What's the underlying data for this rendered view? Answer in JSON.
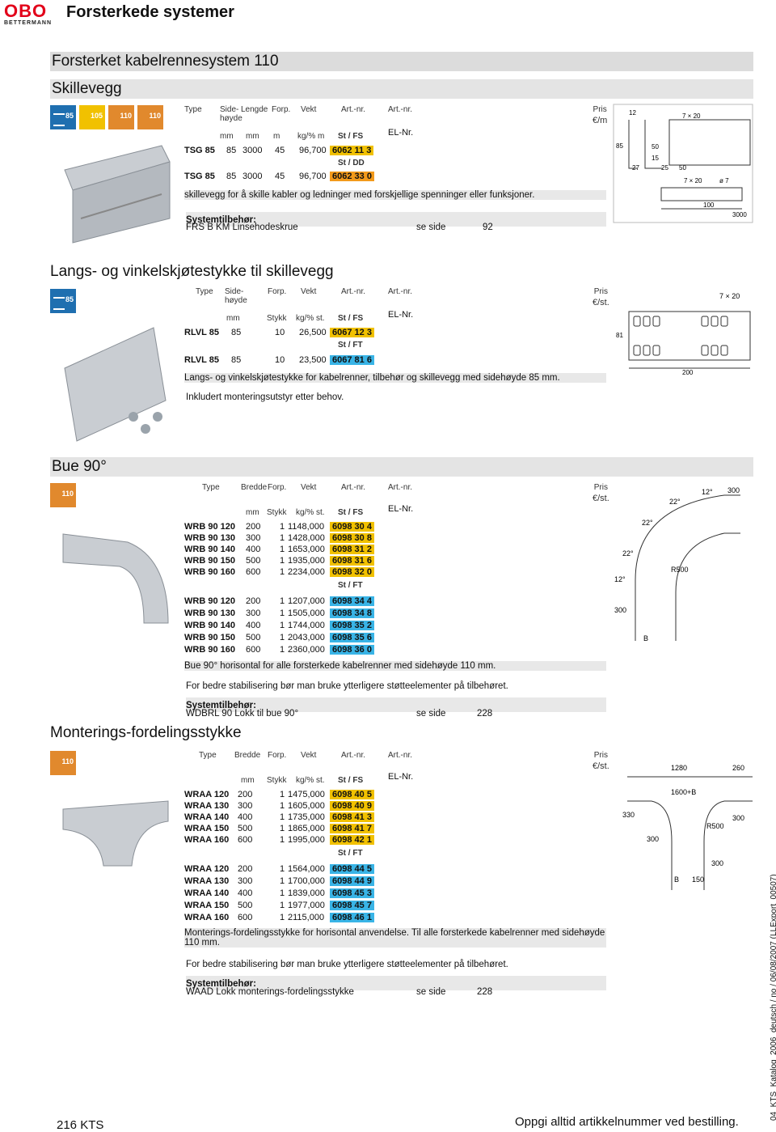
{
  "logo": {
    "mark": "OBO",
    "sub": "BETTERMANN"
  },
  "page_title": "Forsterkede systemer",
  "section_banner": "Forsterket kabelrennesystem 110",
  "skillevegg": {
    "heading": "Skillevegg",
    "badges": [
      "85",
      "105",
      "110",
      "110"
    ],
    "headers": {
      "type": "Type",
      "side": "Side-\nhøyde",
      "lengde": "Lengde",
      "forp": "Forp.",
      "vekt": "Vekt",
      "artnr1": "Art.-nr.",
      "artnr2": "Art.-nr.",
      "pris": "Pris",
      "unit_mm": "mm",
      "unit_mm2": "mm",
      "unit_m": "m",
      "unit_kg": "kg/% m",
      "st_fs": "St   /  FS",
      "elnr": "EL-Nr.",
      "pris_unit": "€/m"
    },
    "rows": [
      {
        "type": "TSG 85",
        "side": "85",
        "lengde": "3000",
        "forp": "45",
        "vekt": "96,700",
        "art": "6062 11 3"
      },
      {
        "type": "TSG 85",
        "side": "85",
        "lengde": "3000",
        "forp": "45",
        "vekt": "96,700",
        "art": "6062 33 0"
      }
    ],
    "st_dd": "St   /  DD",
    "desc": "skillevegg for å skille kabler og ledninger med forskjellige spenninger eller funksjoner.",
    "sys_label": "Systemtilbehør:",
    "sys_item": "FRS B KM   Linsehodeskrue",
    "se_side": "se side",
    "page": "92",
    "dims": [
      "85",
      "12",
      "27",
      "50",
      "15",
      "25",
      "50",
      "7 × 20",
      "7 × 20",
      "ø 7",
      "100",
      "3000"
    ]
  },
  "langs": {
    "heading": "Langs- og vinkelskjøtestykke til skillevegg",
    "badge": "85",
    "headers": {
      "type": "Type",
      "side": "Side-\nhøyde",
      "forp": "Forp.",
      "vekt": "Vekt",
      "artnr1": "Art.-nr.",
      "artnr2": "Art.-nr.",
      "pris": "Pris",
      "unit_mm": "mm",
      "stykk": "Stykk",
      "kg": "kg/% st.",
      "st_fs": "St   /  FS",
      "elnr": "EL-Nr.",
      "pris_unit": "€/st."
    },
    "rows": [
      {
        "type": "RLVL 85",
        "side": "85",
        "forp": "10",
        "vekt": "26,500",
        "art": "6067 12 3"
      },
      {
        "type": "RLVL 85",
        "side": "85",
        "forp": "10",
        "vekt": "23,500",
        "art": "6067 81 6"
      }
    ],
    "st_ft": "St   /  FT",
    "desc1": "Langs- og vinkelskjøtestykke for kabelrenner, tilbehør og skillevegg med sidehøyde 85 mm.",
    "desc2": "Inkludert monteringsutstyr etter behov.",
    "dims": [
      "7 × 20",
      "81",
      "200"
    ]
  },
  "bue": {
    "heading": "Bue 90°",
    "badge": "110",
    "headers": {
      "type": "Type",
      "bredde": "Bredde",
      "forp": "Forp.",
      "vekt": "Vekt",
      "artnr1": "Art.-nr.",
      "artnr2": "Art.-nr.",
      "pris": "Pris",
      "unit_mm": "mm",
      "stykk": "Stykk",
      "kg": "kg/% st.",
      "st_fs": "St   /  FS",
      "elnr": "EL-Nr.",
      "pris_unit": "€/st."
    },
    "rows_fs": [
      {
        "type": "WRB 90 120",
        "bredde": "200",
        "forp": "1",
        "vekt": "1148,000",
        "art": "6098 30 4"
      },
      {
        "type": "WRB 90 130",
        "bredde": "300",
        "forp": "1",
        "vekt": "1428,000",
        "art": "6098 30 8"
      },
      {
        "type": "WRB 90 140",
        "bredde": "400",
        "forp": "1",
        "vekt": "1653,000",
        "art": "6098 31 2"
      },
      {
        "type": "WRB 90 150",
        "bredde": "500",
        "forp": "1",
        "vekt": "1935,000",
        "art": "6098 31 6"
      },
      {
        "type": "WRB 90 160",
        "bredde": "600",
        "forp": "1",
        "vekt": "2234,000",
        "art": "6098 32 0"
      }
    ],
    "st_ft": "St   /  FT",
    "rows_ft": [
      {
        "type": "WRB 90 120",
        "bredde": "200",
        "forp": "1",
        "vekt": "1207,000",
        "art": "6098 34 4"
      },
      {
        "type": "WRB 90 130",
        "bredde": "300",
        "forp": "1",
        "vekt": "1505,000",
        "art": "6098 34 8"
      },
      {
        "type": "WRB 90 140",
        "bredde": "400",
        "forp": "1",
        "vekt": "1744,000",
        "art": "6098 35 2"
      },
      {
        "type": "WRB 90 150",
        "bredde": "500",
        "forp": "1",
        "vekt": "2043,000",
        "art": "6098 35 6"
      },
      {
        "type": "WRB 90 160",
        "bredde": "600",
        "forp": "1",
        "vekt": "2360,000",
        "art": "6098 36 0"
      }
    ],
    "desc1": "Bue 90° horisontal for alle forsterkede kabelrenner med sidehøyde 110 mm.",
    "desc2": "For bedre stabilisering bør man bruke ytterligere støtteelementer på tilbehøret.",
    "sys_label": "Systemtilbehør:",
    "sys_item": "WDBRL 90   Lokk til bue 90°",
    "se_side": "se side",
    "page": "228",
    "dims": [
      "12°",
      "300",
      "22°",
      "22°",
      "22°",
      "12°",
      "R500",
      "300",
      "B"
    ]
  },
  "monterings": {
    "heading": "Monterings-fordelingsstykke",
    "badge": "110",
    "headers": {
      "type": "Type",
      "bredde": "Bredde",
      "forp": "Forp.",
      "vekt": "Vekt",
      "artnr1": "Art.-nr.",
      "artnr2": "Art.-nr.",
      "pris": "Pris",
      "unit_mm": "mm",
      "stykk": "Stykk",
      "kg": "kg/% st.",
      "st_fs": "St   /  FS",
      "elnr": "EL-Nr.",
      "pris_unit": "€/st."
    },
    "rows_fs": [
      {
        "type": "WRAA 120",
        "bredde": "200",
        "forp": "1",
        "vekt": "1475,000",
        "art": "6098 40 5"
      },
      {
        "type": "WRAA 130",
        "bredde": "300",
        "forp": "1",
        "vekt": "1605,000",
        "art": "6098 40 9"
      },
      {
        "type": "WRAA 140",
        "bredde": "400",
        "forp": "1",
        "vekt": "1735,000",
        "art": "6098 41 3"
      },
      {
        "type": "WRAA 150",
        "bredde": "500",
        "forp": "1",
        "vekt": "1865,000",
        "art": "6098 41 7"
      },
      {
        "type": "WRAA 160",
        "bredde": "600",
        "forp": "1",
        "vekt": "1995,000",
        "art": "6098 42 1"
      }
    ],
    "st_ft": "St   /  FT",
    "rows_ft": [
      {
        "type": "WRAA 120",
        "bredde": "200",
        "forp": "1",
        "vekt": "1564,000",
        "art": "6098 44 5"
      },
      {
        "type": "WRAA 130",
        "bredde": "300",
        "forp": "1",
        "vekt": "1700,000",
        "art": "6098 44 9"
      },
      {
        "type": "WRAA 140",
        "bredde": "400",
        "forp": "1",
        "vekt": "1839,000",
        "art": "6098 45 3"
      },
      {
        "type": "WRAA 150",
        "bredde": "500",
        "forp": "1",
        "vekt": "1977,000",
        "art": "6098 45 7"
      },
      {
        "type": "WRAA 160",
        "bredde": "600",
        "forp": "1",
        "vekt": "2115,000",
        "art": "6098 46 1"
      }
    ],
    "desc1": "Monterings-fordelingsstykke for horisontal anvendelse. Til alle forsterkede kabelrenner med sidehøyde 110 mm.",
    "desc2": "For bedre stabilisering bør man bruke ytterligere støtteelementer på tilbehøret.",
    "sys_label": "Systemtilbehør:",
    "sys_item": "WAAD   Lokk monterings-fordelingsstykke",
    "se_side": "se side",
    "page": "228",
    "dims": [
      "1280",
      "260",
      "1600+B",
      "330",
      "R500",
      "300",
      "300",
      "B",
      "150",
      "300"
    ]
  },
  "side_code": "04_KTS_Katalog_2006_deutsch / no / 06/08/2007 (LLExport_00507)",
  "footer": {
    "page": "216  KTS",
    "note": "Oppgi alltid artikkelnummer ved bestilling."
  }
}
